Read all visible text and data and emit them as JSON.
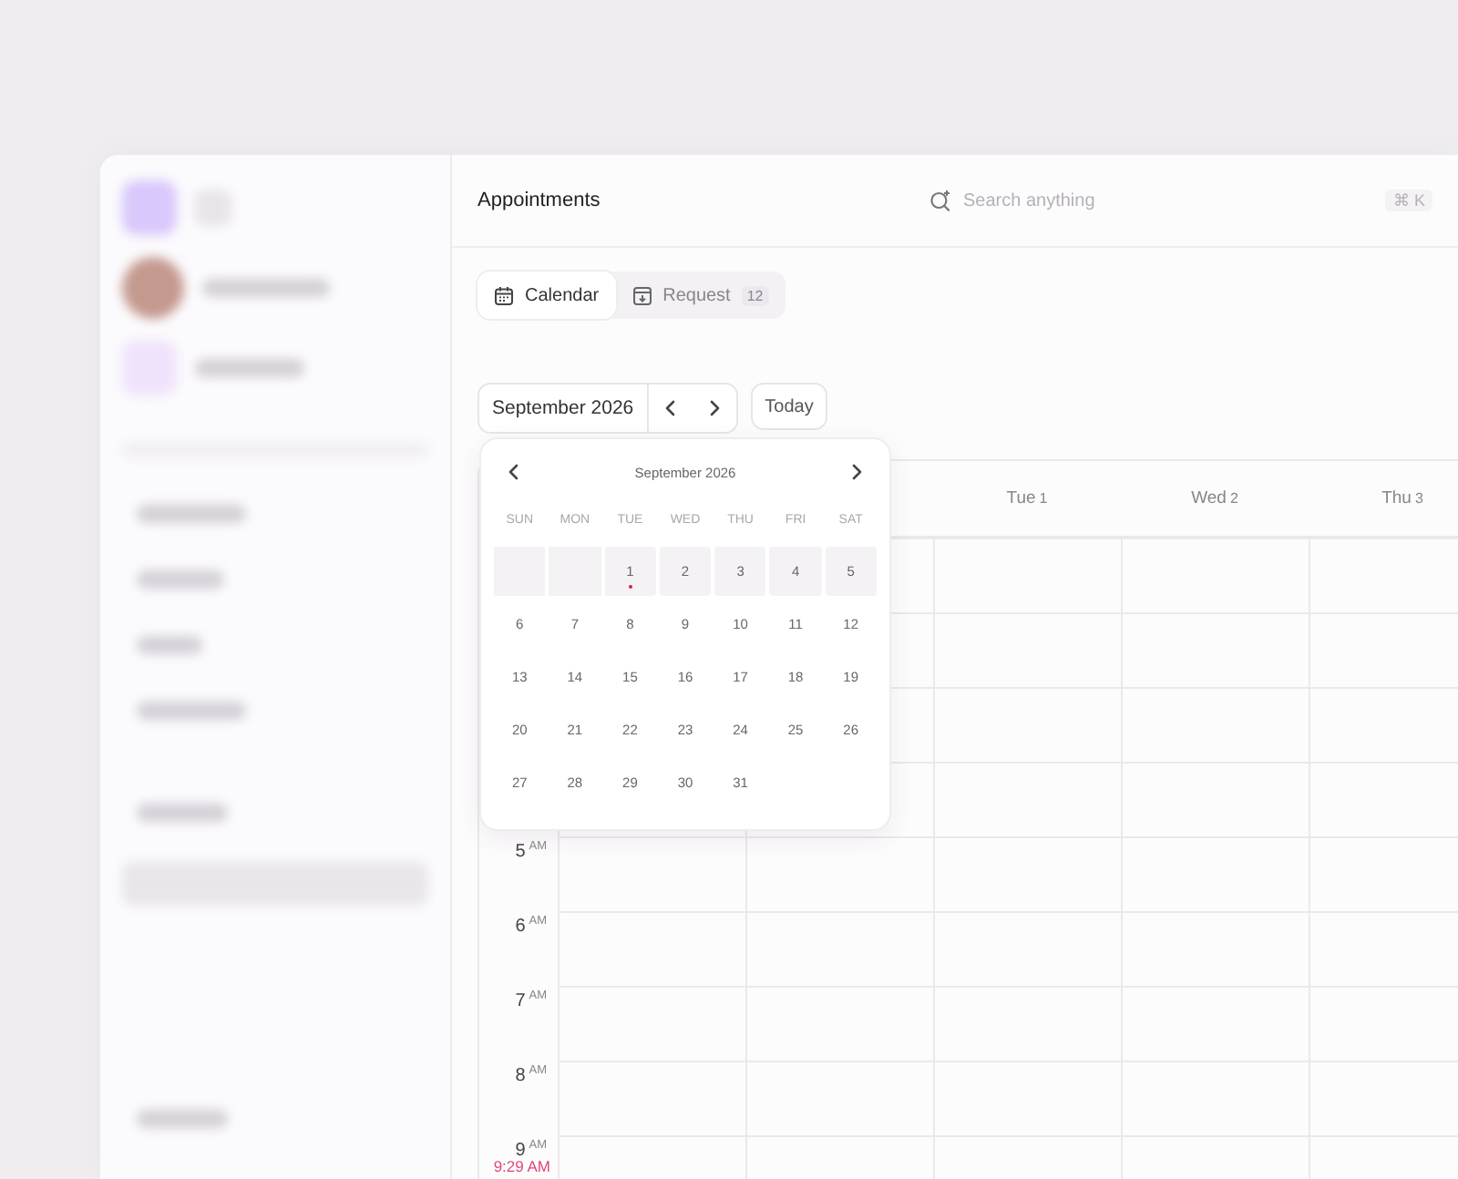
{
  "header": {
    "title": "Appointments",
    "search": {
      "placeholder": "Search anything",
      "shortcut": "⌘ K"
    }
  },
  "tabs": [
    {
      "label": "Calendar",
      "kind": "calendar",
      "selected": true
    },
    {
      "label": "Request",
      "kind": "request",
      "selected": false,
      "count": "12"
    }
  ],
  "toolbar": {
    "month": "September 2026",
    "today": "Today"
  },
  "week": {
    "days": [
      {
        "name": "Tue",
        "date": "1"
      },
      {
        "name": "Wed",
        "date": "2"
      },
      {
        "name": "Thu",
        "date": "3"
      }
    ],
    "hours": [
      {
        "hour": "5",
        "period": "AM"
      },
      {
        "hour": "6",
        "period": "AM"
      },
      {
        "hour": "7",
        "period": "AM"
      },
      {
        "hour": "8",
        "period": "AM"
      },
      {
        "hour": "9",
        "period": "AM"
      }
    ],
    "now_label": "9:29 AM"
  },
  "date_picker": {
    "title": "September 2026",
    "weekdays": [
      "SUN",
      "MON",
      "TUE",
      "WED",
      "THU",
      "FRI",
      "SAT"
    ],
    "weeks": [
      {
        "highlighted": true,
        "days": [
          {
            "kind": "blank"
          },
          {
            "kind": "blank"
          },
          {
            "label": "1",
            "today": true
          },
          {
            "label": "2",
            "today": false
          },
          {
            "label": "3",
            "today": false
          },
          {
            "label": "4",
            "today": false
          },
          {
            "label": "5",
            "today": false
          }
        ]
      },
      {
        "highlighted": false,
        "days": [
          {
            "label": "6",
            "today": false
          },
          {
            "label": "7",
            "today": false
          },
          {
            "label": "8",
            "today": false
          },
          {
            "label": "9",
            "today": false
          },
          {
            "label": "10",
            "today": false
          },
          {
            "label": "11",
            "today": false
          },
          {
            "label": "12",
            "today": false
          }
        ]
      },
      {
        "highlighted": false,
        "days": [
          {
            "label": "13",
            "today": false
          },
          {
            "label": "14",
            "today": false
          },
          {
            "label": "15",
            "today": false
          },
          {
            "label": "16",
            "today": false
          },
          {
            "label": "17",
            "today": false
          },
          {
            "label": "18",
            "today": false
          },
          {
            "label": "19",
            "today": false
          }
        ]
      },
      {
        "highlighted": false,
        "days": [
          {
            "label": "20",
            "today": false
          },
          {
            "label": "21",
            "today": false
          },
          {
            "label": "22",
            "today": false
          },
          {
            "label": "23",
            "today": false
          },
          {
            "label": "24",
            "today": false
          },
          {
            "label": "25",
            "today": false
          },
          {
            "label": "26",
            "today": false
          }
        ]
      },
      {
        "highlighted": false,
        "days": [
          {
            "label": "27",
            "today": false
          },
          {
            "label": "28",
            "today": false
          },
          {
            "label": "29",
            "today": false
          },
          {
            "label": "30",
            "today": false
          },
          {
            "label": "31",
            "today": false
          }
        ]
      }
    ]
  }
}
